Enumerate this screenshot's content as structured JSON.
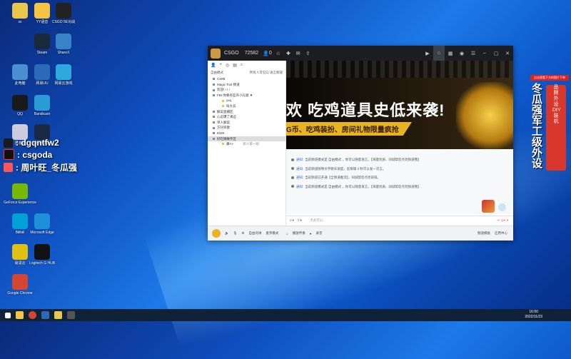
{
  "desktop": {
    "icons": [
      {
        "label": "xx",
        "color": "#e8c84a"
      },
      {
        "label": "YY语音",
        "color": "#f6c445"
      },
      {
        "label": "CSGO 5E对战",
        "color": "#222"
      },
      {
        "label": "Steam",
        "color": "#1b2838"
      },
      {
        "label": "ShareX",
        "color": "#3a82c8"
      },
      {
        "label": "此电脑",
        "color": "#4a90d0"
      },
      {
        "label": "网易UU",
        "color": "#2a6ab8"
      },
      {
        "label": "网易云游戏",
        "color": "#2fa8e0"
      },
      {
        "label": "QQ",
        "color": "#1a1a1a"
      },
      {
        "label": "Bandicam",
        "color": "#2a9bd6"
      },
      {
        "label": "回收站",
        "color": "#ccd"
      },
      {
        "label": "Photoshop",
        "color": "#1a2a44"
      },
      {
        "label": "GeForce Experience",
        "color": "#76b900"
      },
      {
        "label": "Bilibili",
        "color": "#00a1d6"
      },
      {
        "label": "Microsoft Edge",
        "color": "#1e8fd8"
      },
      {
        "label": "易语言",
        "color": "#e0c010"
      },
      {
        "label": "Logitech G HUB",
        "color": "#111"
      },
      {
        "label": "Google Chrome",
        "color": "#d64532"
      }
    ],
    "watermarks": [
      {
        "text": ": dgqntfw2",
        "color": "#3b5"
      },
      {
        "text": ": csgoda",
        "color": "#111"
      },
      {
        "text": ": 周叶旺_冬瓜强",
        "color": "#e44"
      }
    ]
  },
  "window": {
    "app": "CSGO",
    "channel_id": "72582",
    "user_count": "0",
    "titlebar_icons": [
      "play-icon",
      "home-icon",
      "grid-icon",
      "gamepad-icon",
      "menu-icon",
      "minimize-icon",
      "maximize-icon",
      "close-icon"
    ],
    "sidebar": {
      "mode": "自由模式",
      "mode_right": "所有人可见口 语言频道",
      "channels": [
        {
          "name": "CS88",
          "type": "main"
        },
        {
          "name": "Magic Tool 频道",
          "type": "main"
        },
        {
          "name": "欢迎! ! ! !",
          "type": "main"
        },
        {
          "name": "FBI·你要有些许小礼貌 ▼",
          "type": "main"
        },
        {
          "name": "yxq",
          "type": "user"
        },
        {
          "name": "叫大兵",
          "type": "user"
        },
        {
          "name": "解说直播区",
          "type": "main"
        },
        {
          "name": "心态爆了来这",
          "type": "main"
        },
        {
          "name": "单人解说",
          "type": "main"
        },
        {
          "name": "方仔听歌",
          "type": "main"
        },
        {
          "name": "6328",
          "type": "main"
        },
        {
          "name": "好吃懒做专区",
          "type": "main",
          "selected": true
        },
        {
          "name": "康A+",
          "type": "user",
          "extra": "新人第一组"
        }
      ]
    },
    "banner": {
      "headline": "欢 吃鸡道具史低来袭!",
      "sub": "G币、吃鸡装扮、房间礼物限量疯抢"
    },
    "messages": [
      {
        "label": "通知:",
        "text": "当前频道模式是 自由模式 ，你可以随意发言，【海量优质、同城帮您点亮频道哦】"
      },
      {
        "label": "通知:",
        "text": "当前频道限制文字聊天速度，您每隔 3 秒可以发一次言。"
      },
      {
        "label": "通知:",
        "text": "当前频道已开通【全频道推流】，同城帮您点亮前排。"
      },
      {
        "label": "通知:",
        "text": "当前频道模式是 自由模式 ，你可以随意发言，【海量优质、同城帮您点亮频道哦】"
      }
    ],
    "input_placeholder": "点此可以...",
    "bottombar": {
      "items": [
        "自由对讲",
        "麦序模式",
        "播放伴奏",
        "录音"
      ],
      "right_items": [
        "频道模板",
        "应用中心"
      ]
    }
  },
  "ad": {
    "top": "点击观看下方的图片下单",
    "big": "冬瓜强军工级外设",
    "red": "品牌外设DIY装机"
  },
  "taskbar": {
    "time": "16:50",
    "date": "2022/11/23"
  }
}
